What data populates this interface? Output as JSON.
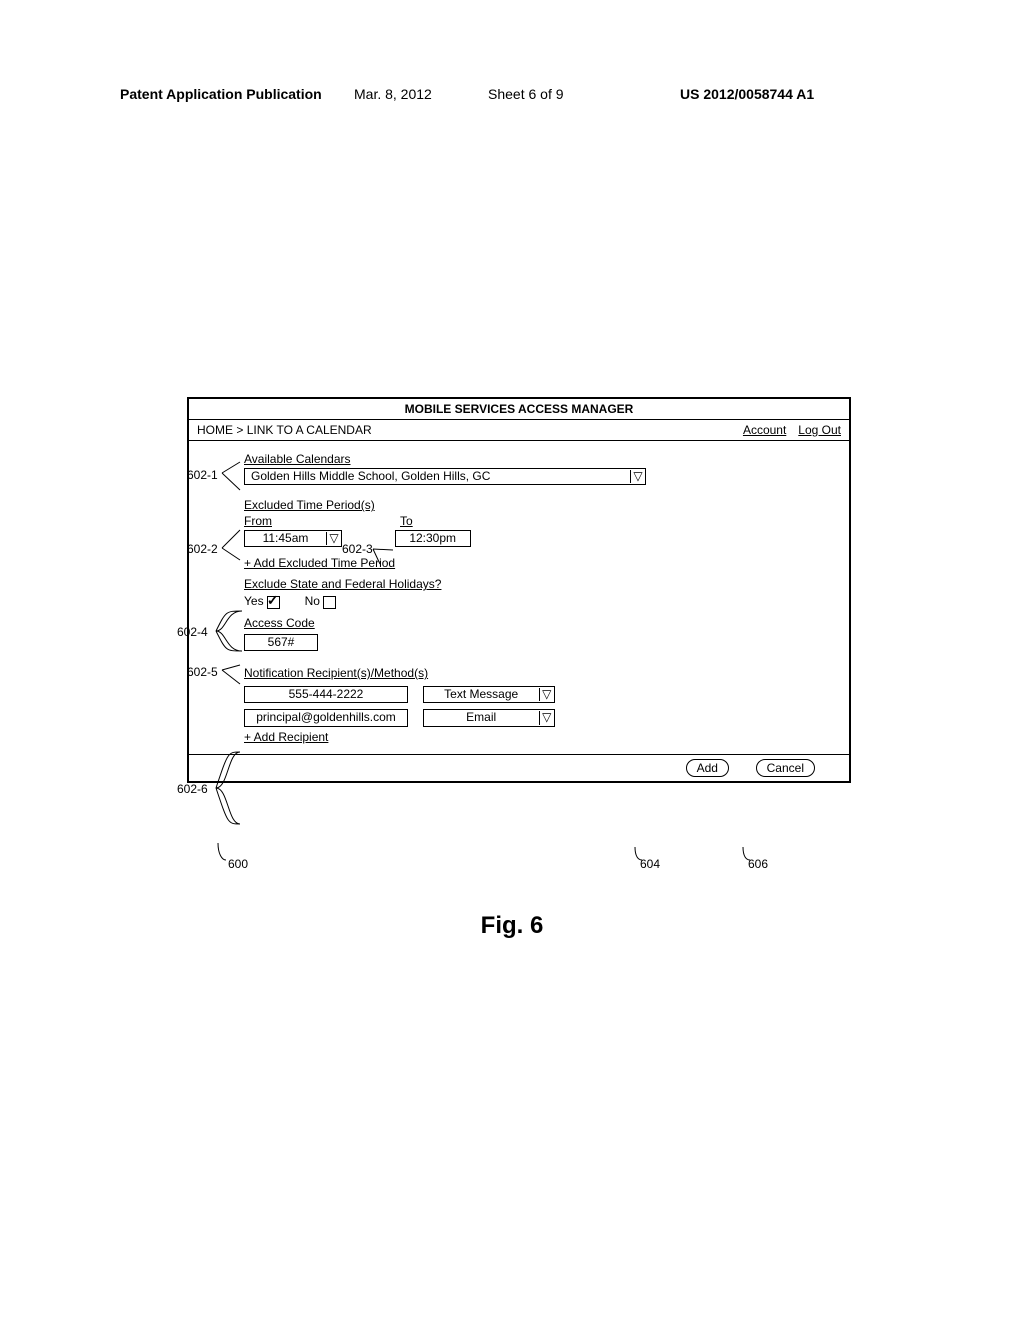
{
  "header": {
    "label": "Patent Application Publication",
    "date": "Mar. 8, 2012",
    "sheet": "Sheet 6 of 9",
    "pubno": "US 2012/0058744 A1"
  },
  "ui": {
    "title": "MOBILE SERVICES ACCESS MANAGER",
    "crumb_home": "HOME",
    "crumb_sep": " > ",
    "crumb_page": "LINK TO A CALENDAR",
    "account": "Account",
    "logout": "Log Out",
    "available_calendars": "Available Calendars",
    "calendar_value": "Golden Hills Middle School, Golden Hills, GC",
    "excluded_periods": "Excluded Time Period(s)",
    "from_label": "From",
    "from_value": "11:45am",
    "to_label": "To",
    "to_value": "12:30pm",
    "add_excluded": "+ Add Excluded Time Period",
    "exclude_holidays": "Exclude State and Federal Holidays?",
    "yes_label": "Yes",
    "no_label": "No",
    "access_code": "Access Code",
    "access_code_value": "567#",
    "notification_methods": "Notification Recipient(s)/Method(s)",
    "recips": [
      {
        "target": "555-444-2222",
        "method": "Text Message"
      },
      {
        "target": "principal@goldenhills.com",
        "method": "Email"
      }
    ],
    "add_recipient": "+ Add Recipient",
    "add_btn": "Add",
    "cancel_btn": "Cancel"
  },
  "callouts": {
    "c1": "602-1",
    "c2": "602-2",
    "c3": "602-3",
    "c4": "602-4",
    "c5": "602-5",
    "c6": "602-6",
    "main": "600",
    "add": "604",
    "cancel": "606"
  },
  "figure_caption": "Fig. 6",
  "dropdown_glyph": "▽"
}
